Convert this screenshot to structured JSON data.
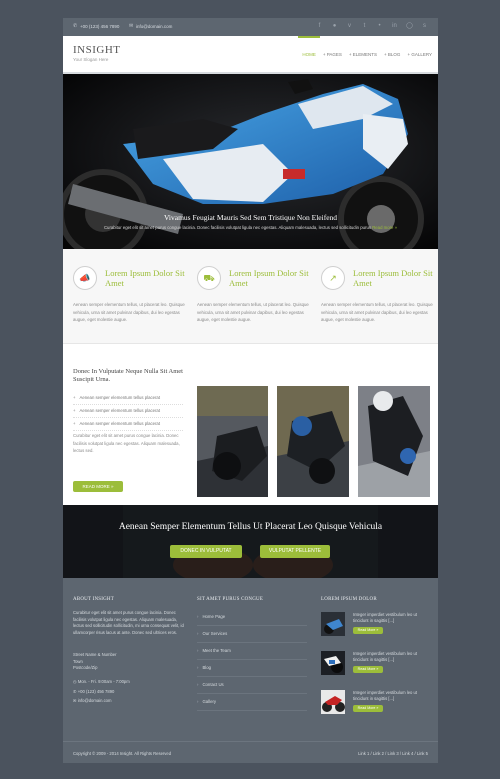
{
  "topbar": {
    "phone": "+00 (123) 456 7890",
    "email": "info@domain.com",
    "social_icons": [
      "facebook-icon",
      "twitter-icon",
      "pinterest-icon",
      "vimeo-icon",
      "flickr-icon",
      "linkedin-icon",
      "dribbble-icon",
      "skype-icon"
    ]
  },
  "header": {
    "logo": "INSIGHT",
    "slogan": "Your Slogan Here",
    "nav": [
      {
        "label": "HOME",
        "active": true
      },
      {
        "label": "+ PAGES"
      },
      {
        "label": "+ ELEMENTS"
      },
      {
        "label": "+ BLOG"
      },
      {
        "label": "+ GALLERY"
      }
    ]
  },
  "hero": {
    "title": "Vivamus Feugiat Mauris Sed Sem Tristique Non Eleifend",
    "text": "Curabitur eget elit sit amet purus congue lacinia. Donec facilisis volutpat ligula nec egestas. Aliquam malesuada, lectus sed sollicitudin purus",
    "more": "Read more »"
  },
  "features": [
    {
      "icon": "megaphone-icon",
      "title": "Lorem Ipsum Dolor Sit Amet",
      "text": "Aenean semper elementum tellus, ut placerat leo. Quisque vehicula, urna sit amet pulvinar dapibus, dui leo egestas augue, eget molestie augue."
    },
    {
      "icon": "car-icon",
      "title": "Lorem Ipsum Dolor Sit Amet",
      "text": "Aenean semper elementum tellus, ut placerat leo. Quisque vehicula, urna sit amet pulvinar dapibus, dui leo egestas augue, eget molestie augue."
    },
    {
      "icon": "chart-icon",
      "title": "Lorem Ipsum Dolor Sit Amet",
      "text": "Aenean semper elementum tellus, ut placerat leo. Quisque vehicula, urna sit amet pulvinar dapibus, dui leo egestas augue, eget molestie augue."
    }
  ],
  "about": {
    "title": "Donec In Vulputate Neque Nulla Sit Amet Suscipit Urna.",
    "list": [
      "Aenean semper elementum tellus placerat",
      "Aenean semper elementum tellus placerat",
      "Aenean semper elementum tellus placerat"
    ],
    "text": "Curabitur eget elit sit amet purus congue lacinia. Donec facilisis volutpat ligula nec egestas. Aliquam malesuada, lectus sed.",
    "button": "READ MORE »"
  },
  "banner": {
    "title": "Aenean Semper Elementum Tellus Ut Placerat Leo Quisque Vehicula",
    "button1": "DONEC IN VULPUTAT",
    "button2": "VULPUTAT PELLENTE"
  },
  "footer": {
    "about_title": "ABOUT INSIGHT",
    "about_text": "Curabitur eget elit sit amet purus congue lacinia. Donec facilisis volutpat ligula nec egestas. Aliquam malesuada, lectus sed sollicitudin sollicitudin, mi urna consequat velit, id ullamcorper risus lacus at ante. Donec sed ultrices eros.",
    "address": [
      "Street Name & Number",
      "Town",
      "Postcode/Zip"
    ],
    "hours": "Mon. - Fri. 9:00am - 7:00pm",
    "phone": "+00 (123) 456 7890",
    "email": "info@domain.com",
    "links_title": "SIT AMET PURUS CONGUE",
    "links": [
      "Home Page",
      "Our Services",
      "Meet the Team",
      "Blog",
      "Contact Us",
      "Gallery"
    ],
    "posts_title": "LOREM IPSUM DOLOR",
    "posts": [
      {
        "text": "Integer imperdiet vestibulum leo ut tincidunt in sagittis [...]",
        "button": "Read More »"
      },
      {
        "text": "Integer imperdiet vestibulum leo ut tincidunt in sagittis [...]",
        "button": "Read More »"
      },
      {
        "text": "Integer imperdiet vestibulum leo ut tincidunt in sagittis [...]",
        "button": "Read More »"
      }
    ]
  },
  "bottom": {
    "copyright": "Copyright © 2009 - 2014 Insight. All Rights Reserved",
    "links": "Link 1 / Link 2 / Link 3 / Link 4 / Link 5"
  },
  "colors": {
    "accent": "#9cbd3a",
    "dark": "#5d6670",
    "background": "#4b535e"
  }
}
